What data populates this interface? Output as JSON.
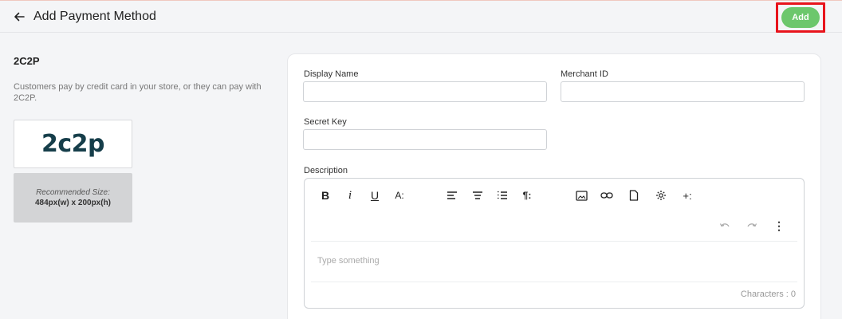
{
  "header": {
    "title": "Add Payment Method",
    "add_label": "Add"
  },
  "provider": {
    "title": "2C2P",
    "description": "Customers pay by credit card in your store, or they can pay with 2C2P.",
    "logo_text": "2c2p",
    "recommended_label": "Recommended Size:",
    "recommended_value": "484px(w) x 200px(h)"
  },
  "form": {
    "display_name_label": "Display Name",
    "display_name_value": "",
    "merchant_id_label": "Merchant ID",
    "merchant_id_value": "",
    "secret_key_label": "Secret Key",
    "secret_key_value": "",
    "description_label": "Description",
    "editor_placeholder": "Type something",
    "char_count": "Characters : 0"
  },
  "toolbar": {
    "bold": "B",
    "italic": "i",
    "underline": "U",
    "font_size": "A:",
    "paragraph": "¶:",
    "more": "+:",
    "overflow": "⋮"
  },
  "icons": {
    "back": "arrow-left-icon",
    "image": "image-icon",
    "link": "link-icon",
    "file": "file-icon",
    "settings": "gear-icon",
    "undo": "undo-icon",
    "redo": "redo-icon"
  },
  "colors": {
    "accent_green": "#6cc76c",
    "highlight_red": "#e8141c",
    "logo_color": "#163e4a"
  }
}
